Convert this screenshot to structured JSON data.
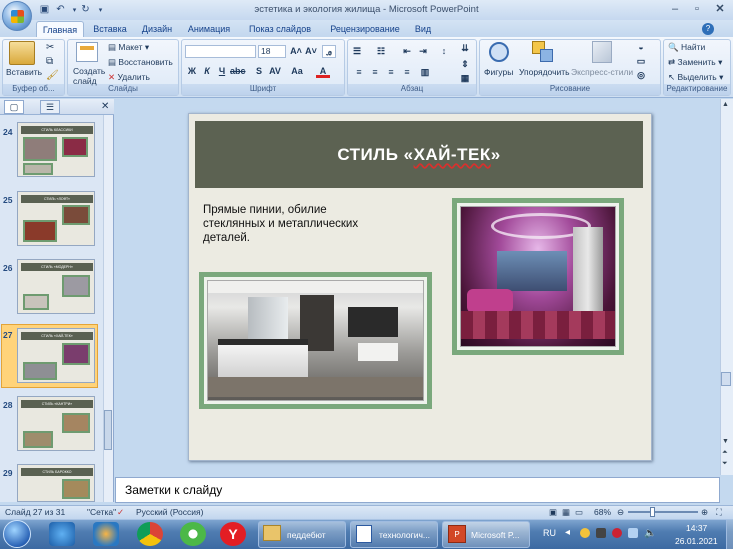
{
  "window": {
    "title": "эстетика и экология жилища - Microsoft PowerPoint"
  },
  "tabs": [
    "Главная",
    "Вставка",
    "Дизайн",
    "Анимация",
    "Показ слайдов",
    "Рецензирование",
    "Вид"
  ],
  "ribbon": {
    "clipboard": {
      "paste": "Вставить",
      "label": "Буфер об..."
    },
    "slides": {
      "new_slide": "Создать слайд",
      "layout": "Макет",
      "reset": "Восстановить",
      "delete": "Удалить",
      "label": "Слайды"
    },
    "font": {
      "font_size": "18",
      "label": "Шрифт",
      "bold": "Ж",
      "italic": "К",
      "underline": "Ч"
    },
    "paragraph": {
      "label": "Абзац"
    },
    "drawing": {
      "shapes": "Фигуры",
      "arrange": "Упорядочить",
      "quick_styles": "Экспресс-стили",
      "label": "Рисование"
    },
    "editing": {
      "find": "Найти",
      "replace": "Заменить",
      "select": "Выделить",
      "label": "Редактирование"
    }
  },
  "thumbnails": [
    {
      "num": "24",
      "title": "СТИЛЬ КЛАССИКИ"
    },
    {
      "num": "25",
      "title": "СТИЛЬ «ЛОФТ»"
    },
    {
      "num": "26",
      "title": "СТИЛЬ «МОДЕРН»"
    },
    {
      "num": "27",
      "title": "СТИЛЬ «ХАЙ-ТЕК»"
    },
    {
      "num": "28",
      "title": "СТИЛЬ «КАНТРИ»"
    },
    {
      "num": "29",
      "title": "СТИЛЬ БАРОККО"
    }
  ],
  "slide": {
    "title_prefix": "СТИЛЬ «",
    "title_word": "ХАЙ-ТЕК",
    "title_suffix": "»",
    "body": "Прямые пинии, обилие стеклянных и метаплических деталей."
  },
  "notes": {
    "placeholder": "Заметки к слайду"
  },
  "status": {
    "slide_info": "Слайд 27 из 31",
    "theme": "\"Сетка\"",
    "language": "Русский (Россия)",
    "zoom": "68%"
  },
  "taskbar": {
    "tasks": [
      "педдебют",
      "технологич...",
      "Microsoft P..."
    ],
    "lang": "RU",
    "time": "14:37",
    "date": "26.01.2021"
  },
  "colors": {
    "slide_title_bg": "#5c6252",
    "photo_frame": "#7aa87c",
    "slide_bg": "#ecebe2"
  }
}
